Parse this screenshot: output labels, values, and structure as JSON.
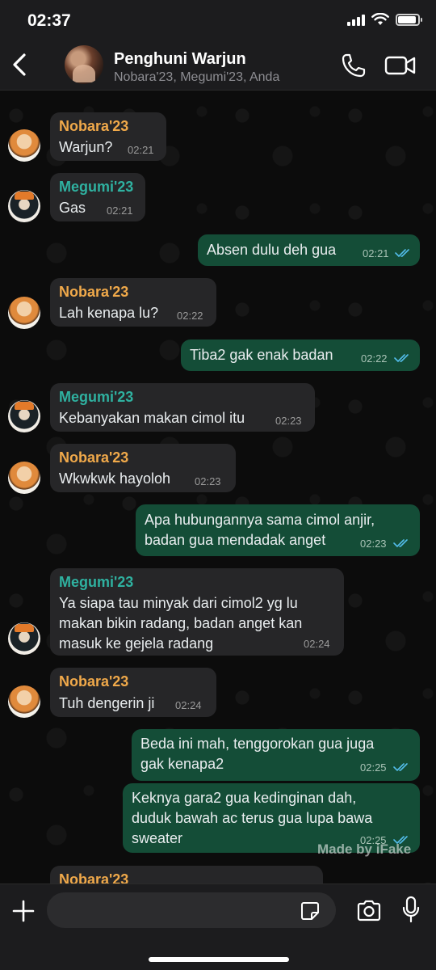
{
  "status_bar": {
    "time": "02:37",
    "battery_level": 0.9
  },
  "header": {
    "title": "Penghuni Warjun",
    "subtitle": "Nobara'23, Megumi'23, Anda",
    "icons": [
      "back-chevron-icon",
      "phone-icon",
      "video-camera-icon"
    ]
  },
  "messages": [
    {
      "direction": "in",
      "sender": "Nobara'23",
      "text": "Warjun?",
      "time": "02:21"
    },
    {
      "direction": "in",
      "sender": "Megumi'23",
      "text": "Gas",
      "time": "02:21"
    },
    {
      "direction": "out",
      "text": "Absen dulu deh gua",
      "time": "02:21",
      "status": "read"
    },
    {
      "direction": "in",
      "sender": "Nobara'23",
      "text": "Lah kenapa lu?",
      "time": "02:22"
    },
    {
      "direction": "out",
      "text": "Tiba2 gak enak badan",
      "time": "02:22",
      "status": "read"
    },
    {
      "direction": "in",
      "sender": "Megumi'23",
      "text": "Kebanyakan makan cimol itu",
      "time": "02:23"
    },
    {
      "direction": "in",
      "sender": "Nobara'23",
      "text": "Wkwkwk hayoloh",
      "time": "02:23"
    },
    {
      "direction": "out",
      "text": "Apa hubungannya sama cimol anjir,\nbadan gua mendadak anget",
      "time": "02:23",
      "status": "read"
    },
    {
      "direction": "in",
      "sender": "Megumi'23",
      "text": "Ya siapa tau minyak dari cimol2 yg lu\nmakan bikin radang, badan anget kan\nmasuk ke gejela radang",
      "time": "02:24"
    },
    {
      "direction": "in",
      "sender": "Nobara'23",
      "text": "Tuh dengerin ji",
      "time": "02:24"
    },
    {
      "direction": "out",
      "text": "Beda ini mah, tenggorokan gua juga\ngak kenapa2",
      "time": "02:25",
      "status": "read"
    },
    {
      "direction": "out",
      "text": "Keknya gara2 gua kedinginan dah,\nduduk bawah ac terus gua lupa bawa\nsweater",
      "time": "02:25",
      "status": "read"
    },
    {
      "direction": "in",
      "sender": "Nobara'23",
      "text": "",
      "time": ""
    }
  ],
  "watermark": "Made by iFake",
  "input_bar": {
    "placeholder": "",
    "icons": [
      "plus-icon",
      "sticker-icon",
      "camera-icon",
      "microphone-icon"
    ]
  },
  "colors": {
    "incoming_bubble": "#262628",
    "outgoing_bubble": "#144d37",
    "nobara_name": "#f0a94a",
    "megumi_name": "#2fb1a0",
    "read_ticks": "#53bdeb"
  }
}
